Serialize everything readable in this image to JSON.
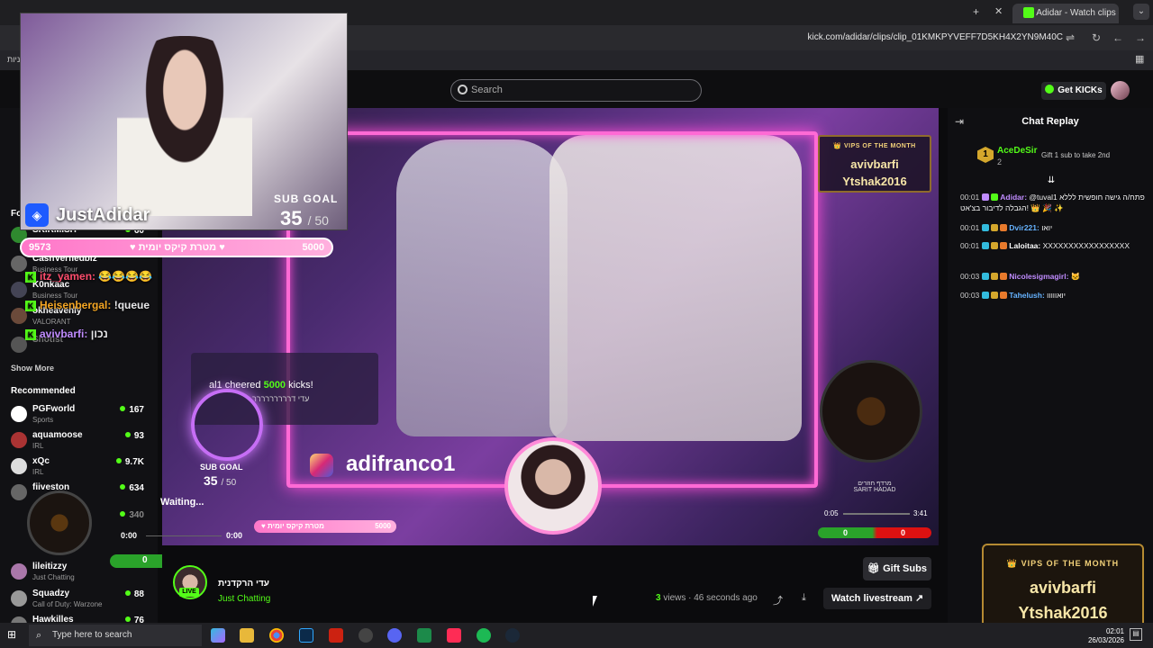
{
  "browser": {
    "tab_title": "Adidar - Watch clips on Kick",
    "url": "kick.com/adidar/clips/clip_01KMKPYVEFF7D5KH4X2YN9M40C",
    "bookmark_fragment": "ניות"
  },
  "header": {
    "search_placeholder": "Search",
    "get_kicks_label": "Get KICKs"
  },
  "sidebar": {
    "following_heading": "Fo",
    "following": [
      {
        "name": "SKIRMISH",
        "category": "",
        "viewers": "60"
      },
      {
        "name": "CashVerfiedbiz",
        "category": "Business Tour",
        "viewers": ""
      },
      {
        "name": "K0nkaac",
        "category": "Business Tour",
        "viewers": ""
      },
      {
        "name": "okheavenly",
        "category": "VALORANT",
        "viewers": ""
      },
      {
        "name": "Shotist",
        "category": "",
        "viewers": ""
      }
    ],
    "show_more": "Show More",
    "recommended_heading": "Recommended",
    "recommended": [
      {
        "name": "PGFworld",
        "category": "Sports",
        "viewers": "167"
      },
      {
        "name": "aquamoose",
        "category": "IRL",
        "viewers": "93"
      },
      {
        "name": "xQc",
        "category": "IRL",
        "viewers": "9.7K"
      },
      {
        "name": "fiiveston",
        "category": "",
        "viewers": "634"
      },
      {
        "name": "",
        "category": "",
        "viewers": "340"
      },
      {
        "name": "lileitizzy",
        "category": "Just Chatting",
        "viewers": ""
      },
      {
        "name": "Squadzy",
        "category": "Call of Duty: Warzone",
        "viewers": "88"
      },
      {
        "name": "Hawkilles",
        "category": "",
        "viewers": "76"
      }
    ]
  },
  "stream_overlay": {
    "streamer_name": "JustAdidar",
    "subgoal_label": "SUB GOAL",
    "subgoal_current": "35",
    "subgoal_total": "/ 50",
    "kicks_bar_left": "9573",
    "kicks_bar_middle": "♥ מטרת קיקס יומית ♥",
    "kicks_bar_right": "5000",
    "chat_lines": [
      {
        "user": "itz_yamen:",
        "text": "😂😂😂😂",
        "color": "#ff4d6d"
      },
      {
        "user": "Heisenbergal:",
        "text": "!queue",
        "color": "#f5a623"
      },
      {
        "user": "avivbarfi:",
        "text": "נכון",
        "color": "#c08cff"
      }
    ],
    "cheer_user": "al1",
    "cheer_word": "cheered",
    "cheer_amount": "5000",
    "cheer_suffix": "kicks!",
    "cheer_message": "עדי דררררררררר",
    "instagram": "adifranco1",
    "vips_title": "👑 VIPS OF THE MONTH",
    "vips_names": [
      "avivbarfi",
      "Ytshak2016"
    ],
    "music_title": "מרדף חוזרים",
    "music_artist": "SARIT HADAD",
    "music_time_start": "0:05",
    "music_time_end": "3:41",
    "score_left": "0",
    "score_right": "0",
    "waiting_text": "Waiting...",
    "waiting_time_start": "0:00",
    "waiting_time_end": "0:00",
    "mini_bar_text": "♥ מטרת קיקס יומית",
    "mini_bar_value": "5000"
  },
  "chat": {
    "title": "Chat Replay",
    "pinned": {
      "rank": "1",
      "name": "AceDeSir",
      "count": "2",
      "gift_text": "Gift 1 sub to take 2nd"
    },
    "messages": [
      {
        "time": "00:01",
        "user": "Adidar:",
        "text": "@tuval1 פתח/ה גישה חופשית לללא הגבלה לדיבור בצ'אט! 👑 🎉 ✨",
        "color": "#c08cff"
      },
      {
        "time": "00:01",
        "user": "Dvir221:",
        "text": "יואו",
        "color": "#66b3ff"
      },
      {
        "time": "00:01",
        "user": "Laloitaa:",
        "text": "XXXXXXXXXXXXXXXXX",
        "color": "#ffffff"
      },
      {
        "time": "00:03",
        "user": "Nicolesigmagirl:",
        "text": "🐱",
        "color": "#c08cff"
      },
      {
        "time": "00:03",
        "user": "Tahelush:",
        "text": "יואווווו",
        "color": "#66b3ff"
      }
    ]
  },
  "channel": {
    "name": "עדי הרקדנית",
    "category": "Just Chatting",
    "live_label": "LIVE",
    "views_count": "3",
    "views_label": "views",
    "time_ago": "· 46 seconds ago",
    "gift_subs": "Gift Subs",
    "watch_live": "Watch livestream"
  },
  "vips_float": {
    "title": "👑 VIPS OF THE MONTH",
    "names": [
      "avivbarfi",
      "Ytshak2016"
    ]
  },
  "taskbar": {
    "search_placeholder": "Type here to search",
    "time": "02:01",
    "date": "26/03/2026"
  },
  "colors": {
    "kick_green": "#53fc18",
    "overlay_pink": "#ff6ad5",
    "gold": "#f3d27a"
  }
}
